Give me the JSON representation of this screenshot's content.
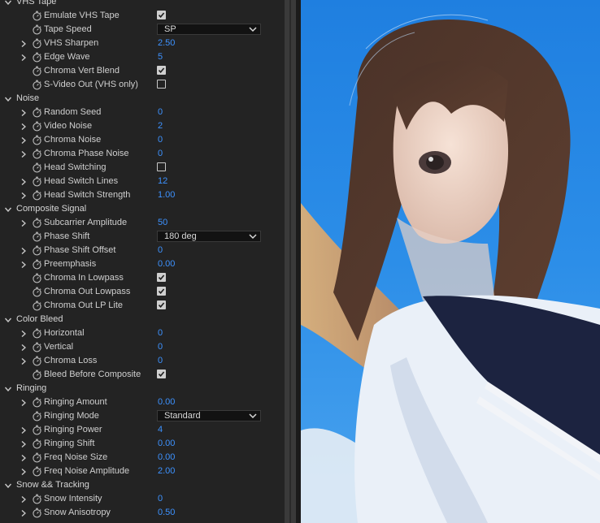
{
  "groups": [
    {
      "title": "VHS Tape",
      "params": [
        {
          "label": "Emulate VHS Tape",
          "type": "checkbox",
          "checked": true,
          "expandable": false
        },
        {
          "label": "Tape Speed",
          "type": "dropdown",
          "value": "SP",
          "expandable": false
        },
        {
          "label": "VHS Sharpen",
          "type": "number",
          "value": "2.50",
          "expandable": true
        },
        {
          "label": "Edge Wave",
          "type": "number",
          "value": "5",
          "expandable": true
        },
        {
          "label": "Chroma Vert Blend",
          "type": "checkbox",
          "checked": true,
          "expandable": false
        },
        {
          "label": "S-Video Out (VHS only)",
          "type": "checkbox",
          "checked": false,
          "expandable": false
        }
      ]
    },
    {
      "title": "Noise",
      "params": [
        {
          "label": "Random Seed",
          "type": "number",
          "value": "0",
          "expandable": true
        },
        {
          "label": "Video Noise",
          "type": "number",
          "value": "2",
          "expandable": true
        },
        {
          "label": "Chroma Noise",
          "type": "number",
          "value": "0",
          "expandable": true
        },
        {
          "label": "Chroma Phase Noise",
          "type": "number",
          "value": "0",
          "expandable": true
        },
        {
          "label": "Head Switching",
          "type": "checkbox",
          "checked": false,
          "expandable": false
        },
        {
          "label": "Head Switch Lines",
          "type": "number",
          "value": "12",
          "expandable": true
        },
        {
          "label": "Head Switch Strength",
          "type": "number",
          "value": "1.00",
          "expandable": true
        }
      ]
    },
    {
      "title": "Composite Signal",
      "params": [
        {
          "label": "Subcarrier Amplitude",
          "type": "number",
          "value": "50",
          "expandable": true
        },
        {
          "label": "Phase Shift",
          "type": "dropdown",
          "value": "180 deg",
          "expandable": false
        },
        {
          "label": "Phase Shift Offset",
          "type": "number",
          "value": "0",
          "expandable": true
        },
        {
          "label": "Preemphasis",
          "type": "number",
          "value": "0.00",
          "expandable": true
        },
        {
          "label": "Chroma In Lowpass",
          "type": "checkbox",
          "checked": true,
          "expandable": false
        },
        {
          "label": "Chroma Out Lowpass",
          "type": "checkbox",
          "checked": true,
          "expandable": false
        },
        {
          "label": "Chroma Out LP Lite",
          "type": "checkbox",
          "checked": true,
          "expandable": false
        }
      ]
    },
    {
      "title": "Color Bleed",
      "params": [
        {
          "label": "Horizontal",
          "type": "number",
          "value": "0",
          "expandable": true
        },
        {
          "label": "Vertical",
          "type": "number",
          "value": "0",
          "expandable": true
        },
        {
          "label": "Chroma Loss",
          "type": "number",
          "value": "0",
          "expandable": true
        },
        {
          "label": "Bleed Before Composite",
          "type": "checkbox",
          "checked": true,
          "expandable": false
        }
      ]
    },
    {
      "title": "Ringing",
      "params": [
        {
          "label": "Ringing Amount",
          "type": "number",
          "value": "0.00",
          "expandable": true
        },
        {
          "label": "Ringing Mode",
          "type": "dropdown",
          "value": "Standard",
          "expandable": false
        },
        {
          "label": "Ringing Power",
          "type": "number",
          "value": "4",
          "expandable": true
        },
        {
          "label": "Ringing Shift",
          "type": "number",
          "value": "0.00",
          "expandable": true
        },
        {
          "label": "Freq Noise Size",
          "type": "number",
          "value": "0.00",
          "expandable": true
        },
        {
          "label": "Freq Noise Amplitude",
          "type": "number",
          "value": "2.00",
          "expandable": true
        }
      ]
    },
    {
      "title": "Snow && Tracking",
      "params": [
        {
          "label": "Snow Intensity",
          "type": "number",
          "value": "0",
          "expandable": true
        },
        {
          "label": "Snow Anisotropy",
          "type": "number",
          "value": "0.50",
          "expandable": true
        }
      ]
    }
  ],
  "colors": {
    "value_blue": "#3d92ff",
    "panel_bg": "#232323",
    "sky": "#2f8be6"
  },
  "icons": {
    "stopwatch": "stopwatch-icon",
    "expand": "chevron-right-icon",
    "collapse": "chevron-down-icon",
    "dropdown": "chevron-down-icon"
  }
}
